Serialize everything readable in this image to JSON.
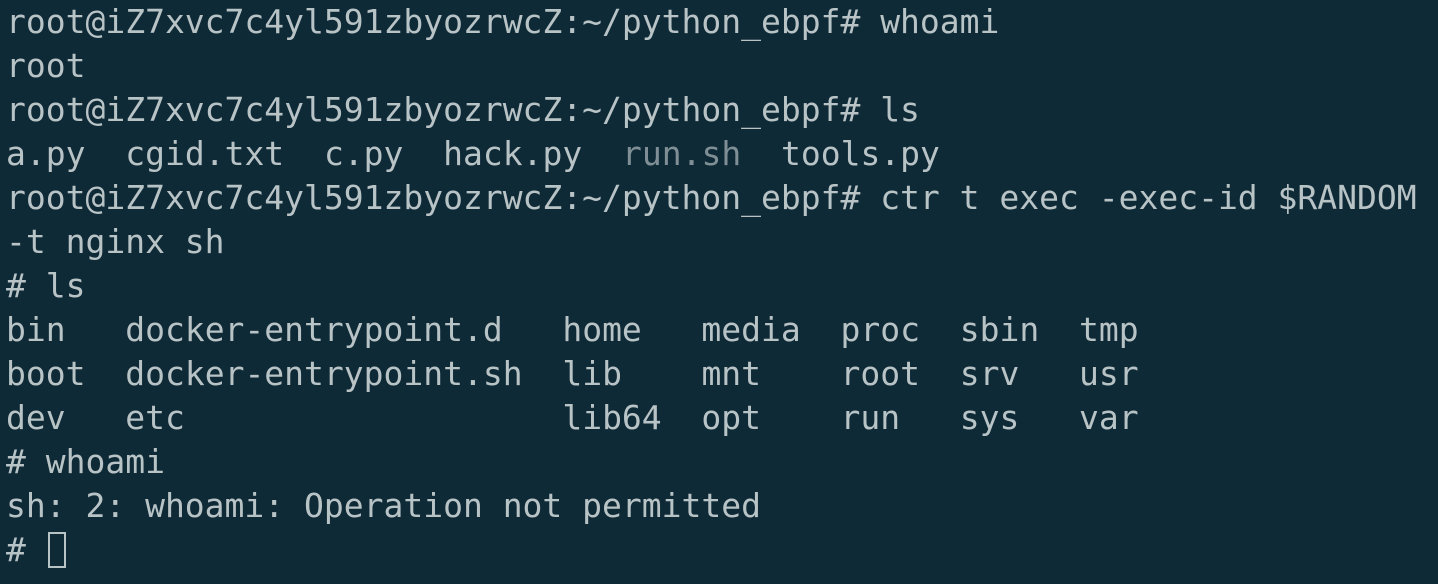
{
  "terminal": {
    "lines": [
      {
        "prompt": "root@iZ7xvc7c4yl591zbyozrwcZ:~/python_ebpf#",
        "command": "whoami"
      },
      {
        "output": "root"
      },
      {
        "prompt": "root@iZ7xvc7c4yl591zbyozrwcZ:~/python_ebpf#",
        "command": "ls"
      },
      {
        "files": [
          "a.py",
          "cgid.txt",
          "c.py",
          "hack.py",
          "run.sh",
          "tools.py"
        ]
      },
      {
        "prompt": "root@iZ7xvc7c4yl591zbyozrwcZ:~/python_ebpf#",
        "command": "ctr t exec -exec-id $RANDOM"
      },
      {
        "output": "-t nginx sh"
      },
      {
        "prompt": "#",
        "command": "ls"
      },
      {
        "row": [
          "bin",
          "docker-entrypoint.d",
          "home",
          "media",
          "proc",
          "sbin",
          "tmp"
        ]
      },
      {
        "row": [
          "boot",
          "docker-entrypoint.sh",
          "lib",
          "mnt",
          "root",
          "srv",
          "usr"
        ]
      },
      {
        "row": [
          "dev",
          "etc",
          "",
          "lib64",
          "opt",
          "run",
          "sys",
          "var"
        ]
      },
      {
        "prompt": "#",
        "command": "whoami"
      },
      {
        "output": "sh: 2: whoami: Operation not permitted"
      },
      {
        "prompt": "#"
      }
    ]
  },
  "colors": {
    "background": "#0f2a37",
    "text": "#b8c3c6",
    "dim": "#7f8f95"
  }
}
